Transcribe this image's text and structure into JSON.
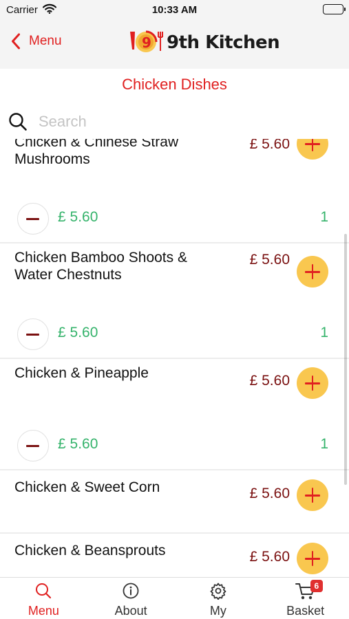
{
  "status_bar": {
    "carrier": "Carrier",
    "time": "10:33 AM"
  },
  "nav": {
    "back_label": "Menu",
    "logo_text": "9th Kitchen"
  },
  "page": {
    "title": "Chicken Dishes"
  },
  "search": {
    "placeholder": "Search",
    "value": ""
  },
  "items": [
    {
      "name": "Chicken & Chinese Straw Mushrooms",
      "price": "£ 5.60",
      "subtotal": "£ 5.60",
      "qty": "1"
    },
    {
      "name": "Chicken Bamboo Shoots & Water Chestnuts",
      "price": "£ 5.60",
      "subtotal": "£ 5.60",
      "qty": "1"
    },
    {
      "name": "Chicken & Pineapple",
      "price": "£ 5.60",
      "subtotal": "£ 5.60",
      "qty": "1"
    },
    {
      "name": "Chicken & Sweet Corn",
      "price": "£ 5.60"
    },
    {
      "name": "Chicken & Beansprouts",
      "price": "£ 5.60"
    }
  ],
  "tabs": [
    {
      "label": "Menu",
      "icon": "search-icon"
    },
    {
      "label": "About",
      "icon": "info-icon"
    },
    {
      "label": "My",
      "icon": "gear-icon"
    },
    {
      "label": "Basket",
      "icon": "cart-icon",
      "badge": "6"
    }
  ],
  "colors": {
    "accent_red": "#e02020",
    "add_yellow": "#f9c74f",
    "price_dark_red": "#7a1010",
    "subtotal_green": "#35b36b"
  }
}
